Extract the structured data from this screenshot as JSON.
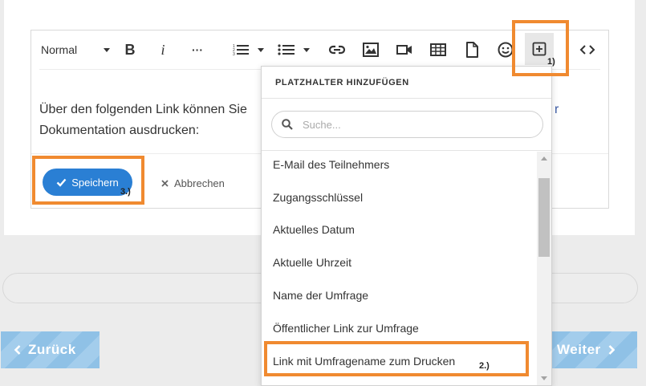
{
  "toolbar": {
    "format_label": "Normal",
    "icons": [
      "chevron-down-icon",
      "bold-icon",
      "italic-icon",
      "more-icon",
      "ordered-list-icon",
      "bullet-list-icon",
      "link-icon",
      "image-icon",
      "video-icon",
      "table-icon",
      "file-icon",
      "emoji-icon",
      "add-placeholder-icon",
      "code-view-icon"
    ],
    "bold_label": "B",
    "italic_label": "i",
    "more_label": "···"
  },
  "editor": {
    "content_line1": "Über den folgenden Link können Sie",
    "content_link_fragment": "r",
    "content_line2": "Dokumentation ausdrucken:"
  },
  "footer": {
    "save_label": "Speichern",
    "cancel_label": "Abbrechen"
  },
  "navigation": {
    "back_label": "Zurück",
    "next_label": "Weiter"
  },
  "dropdown": {
    "title": "PLATZHALTER HINZUFÜGEN",
    "search_placeholder": "Suche...",
    "items": [
      "E-Mail des Teilnehmers",
      "Zugangsschlüssel",
      "Aktuelles Datum",
      "Aktuelle Uhrzeit",
      "Name der Umfrage",
      "Öffentlicher Link zur Umfrage",
      "Link mit Umfragename zum Drucken"
    ]
  },
  "annotations": {
    "step1": "1)",
    "step2": "2.)",
    "step3": "3.)"
  },
  "colors": {
    "highlight": "#f08a30",
    "primary_button": "#2a7fd4",
    "nav_button": "#8fc1e6",
    "link_text": "#3b5ba5"
  }
}
